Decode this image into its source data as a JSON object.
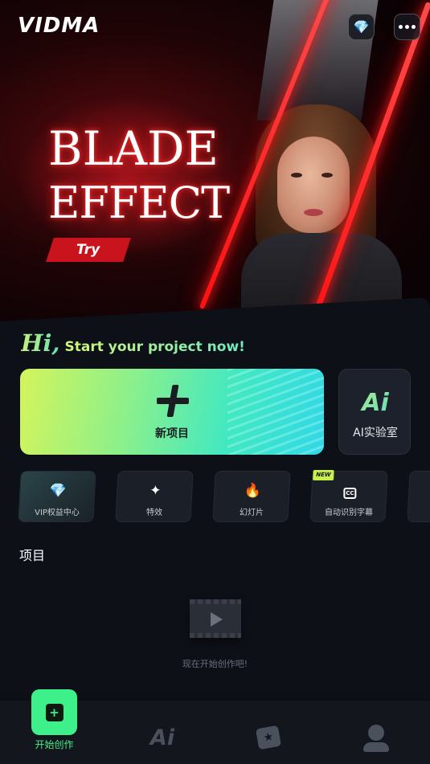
{
  "header": {
    "logo": "VIDMA",
    "vip_icon": "diamond-icon",
    "more_icon": "more-dots-icon"
  },
  "banner": {
    "title_line1": "BLADE",
    "title_line2": "EFFECT",
    "try_label": "Try"
  },
  "greeting": {
    "hi": "Hi,",
    "tagline": "Start your project now!"
  },
  "new_project": {
    "label": "新项目",
    "icon": "plus-icon"
  },
  "ai_lab": {
    "logo": "Ai",
    "label": "AI实验室"
  },
  "tools": [
    {
      "label": "VIP权益中心",
      "icon": "diamond-icon",
      "glyph": "💎",
      "badge": ""
    },
    {
      "label": "特效",
      "icon": "sparkle-icon",
      "glyph": "✦",
      "badge": ""
    },
    {
      "label": "幻灯片",
      "icon": "flame-icon",
      "glyph": "🔥",
      "badge": ""
    },
    {
      "label": "自动识别字幕",
      "icon": "cc-ai-icon",
      "glyph": "CC",
      "badge": "NEW"
    }
  ],
  "projects": {
    "title": "项目",
    "empty_text": "现在开始创作吧!"
  },
  "bottom_nav": {
    "create_label": "开始创作",
    "ai_label": "Ai",
    "colors": {
      "active": "#3df08a",
      "inactive": "#4a505c"
    }
  }
}
